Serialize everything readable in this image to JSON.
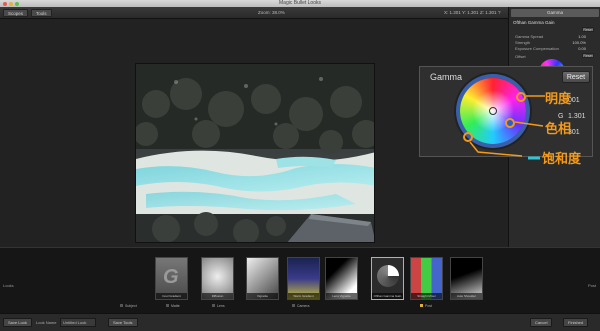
{
  "window": {
    "title": "Magic Bullet Looks"
  },
  "toolbar": {
    "left_buttons": [
      "Scopes",
      "Tools"
    ],
    "center_label": "Zoom: 38.0%",
    "right_values": [
      "X: 1.301",
      "Y: 1.301",
      "Z: 1.301"
    ]
  },
  "panel": {
    "header": "Gamma",
    "tool_name": "Ofthan Gamma Gain",
    "rows": [
      {
        "label": "Gamma Spread",
        "value": "1.00"
      },
      {
        "label": "Strength",
        "value": "100.0%"
      },
      {
        "label": "Exposure Compensation",
        "value": "0.00"
      }
    ],
    "section2": "Offset",
    "reset_label": "Reset",
    "lower_value": "0.000"
  },
  "gamma_zoom": {
    "title": "Gamma",
    "reset_label": "Reset",
    "values": [
      "001",
      "1.301",
      "301"
    ],
    "value_prefix": "G"
  },
  "callouts": {
    "brightness": "明度",
    "hue": "色相",
    "saturation": "饱和度"
  },
  "strip": {
    "left_label": "Looks",
    "right_label": "Post",
    "thumbnails": [
      {
        "caption": "Cool Gradient"
      },
      {
        "caption": "Diffusion"
      },
      {
        "caption": "Vignette"
      },
      {
        "caption": "Warm Gradient"
      },
      {
        "caption": "Lens Vignette"
      },
      {
        "caption": "Ofthan Gamma Gain"
      },
      {
        "caption": "Straight Mixer"
      },
      {
        "caption": "Auto Shoulder"
      }
    ],
    "category_labels": [
      "Subject",
      "Matte",
      "Lens",
      "Camera",
      "Post"
    ]
  },
  "bottombar": {
    "left_button": "Save Look",
    "name_label": "Look Name",
    "name_value": "Untitled Look",
    "mid_button": "Save Tools",
    "right_buttons": [
      "Cancel",
      "Finished"
    ]
  },
  "colors": {
    "accent": "#f39a1a",
    "panel_header": "#5a5a5a"
  }
}
